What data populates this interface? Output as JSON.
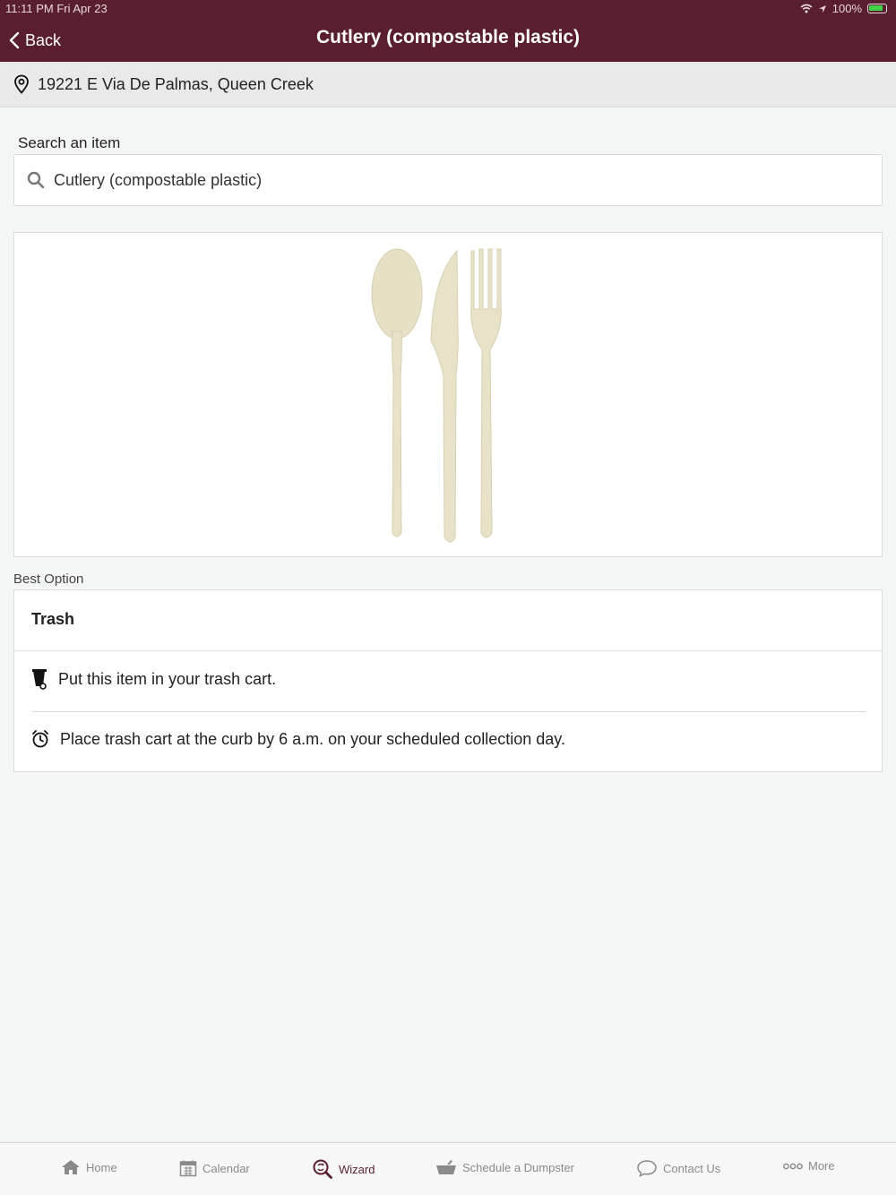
{
  "status_bar": {
    "time": "11:11 PM   Fri Apr 23",
    "battery": "100%"
  },
  "header": {
    "back_label": "Back",
    "title": "Cutlery (compostable plastic)"
  },
  "address": {
    "text": "19221 E Via De Palmas, Queen Creek"
  },
  "search": {
    "label": "Search an item",
    "value": "Cutlery (compostable plastic)"
  },
  "best_option": {
    "section_label": "Best Option",
    "title": "Trash",
    "instructions": [
      {
        "icon": "trash-cart-icon",
        "text": "Put this item in your trash cart."
      },
      {
        "icon": "alarm-clock-icon",
        "text": "Place trash cart at the curb by 6 a.m. on your scheduled collection day."
      }
    ]
  },
  "tabs": [
    {
      "icon": "home-icon",
      "label": "Home",
      "active": false
    },
    {
      "icon": "calendar-icon",
      "label": "Calendar",
      "active": false
    },
    {
      "icon": "wizard-icon",
      "label": "Wizard",
      "active": true
    },
    {
      "icon": "dumpster-icon",
      "label": "Schedule a Dumpster",
      "active": false
    },
    {
      "icon": "chat-bubble-icon",
      "label": "Contact Us",
      "active": false
    },
    {
      "icon": "more-dots-icon",
      "label": "More",
      "active": false
    }
  ],
  "colors": {
    "header_bg": "#5a1f2e",
    "accent": "#5a1f2e",
    "page_bg": "#f4f6f5",
    "cutlery": "#e8e2c8"
  }
}
